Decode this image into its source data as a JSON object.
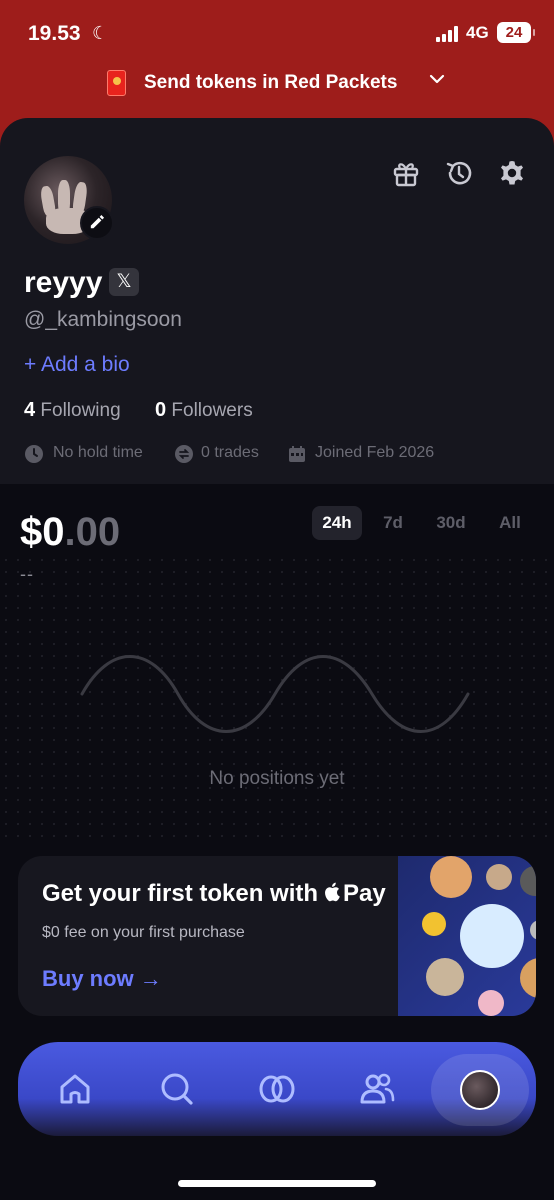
{
  "status_bar": {
    "time": "19.53",
    "network": "4G",
    "battery": "24"
  },
  "promo_banner": {
    "text": "Send tokens in Red Packets"
  },
  "profile": {
    "username": "reyyy",
    "x_badge": "𝕏",
    "handle": "@_kambingsoon",
    "add_bio": "+ Add a bio",
    "following_count": "4",
    "following_label": "Following",
    "followers_count": "0",
    "followers_label": "Followers",
    "hold_time": "No hold time",
    "trades": "0 trades",
    "joined": "Joined Feb 2026"
  },
  "portfolio": {
    "balance_main": "$0",
    "balance_decimals": ".00",
    "change": "--",
    "ranges": [
      "24h",
      "7d",
      "30d",
      "All"
    ],
    "active_range": "24h",
    "empty_message": "No positions yet"
  },
  "promo_card": {
    "title": "Get your first token with",
    "title_pay": "Pay",
    "subtitle": "$0 fee on your first purchase",
    "cta": "Buy now →"
  },
  "colors": {
    "topbar": "#9e1d1b",
    "accent": "#6d7cff",
    "nav": "#4a5ae0",
    "background": "#0b0b12"
  },
  "nav": {
    "items": [
      "home-icon",
      "search-icon",
      "trade-icon",
      "people-icon",
      "profile-avatar"
    ]
  }
}
